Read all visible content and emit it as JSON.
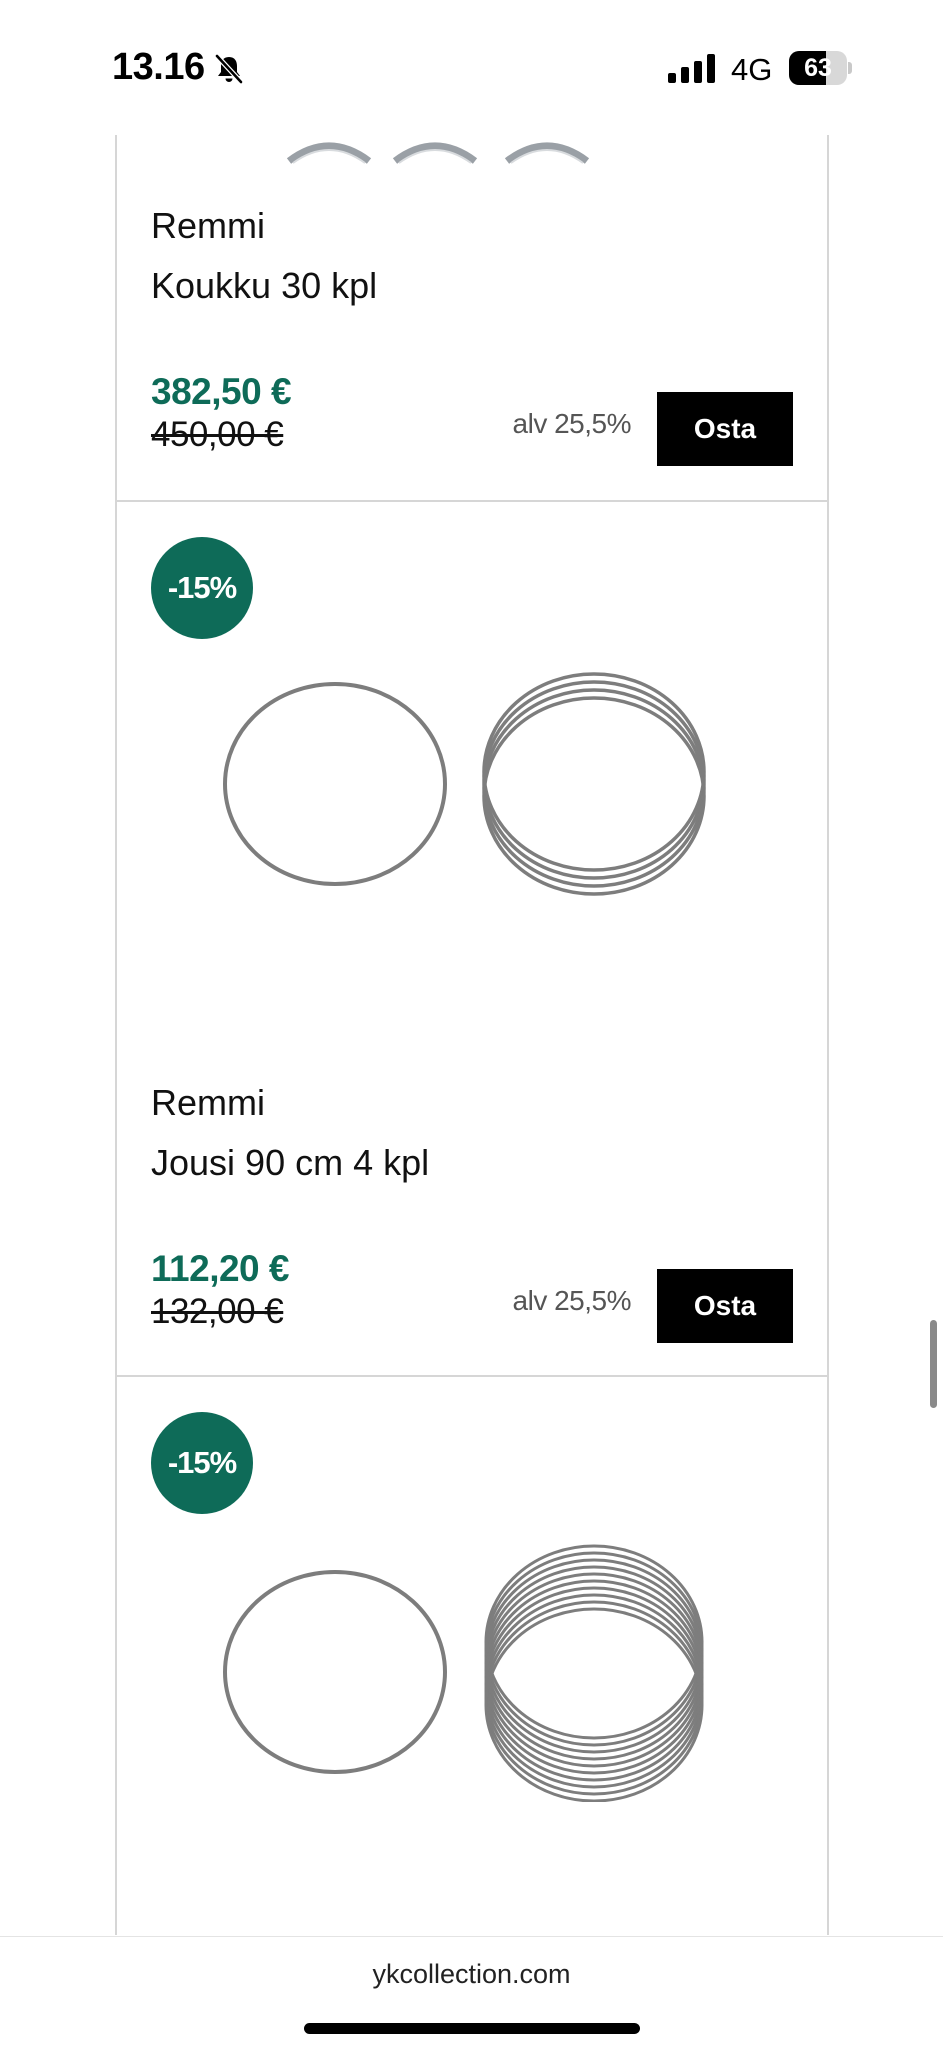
{
  "status_bar": {
    "time": "13.16",
    "network": "4G",
    "battery_level": "63",
    "battery_fraction": 0.63
  },
  "products": [
    {
      "brand": "Remmi",
      "name": "Koukku 30 kpl",
      "price": "382,50 €",
      "old_price": "450,00 €",
      "vat": "alv 25,5%",
      "buy_label": "Osta"
    },
    {
      "badge": "-15%",
      "brand": "Remmi",
      "name": "Jousi 90 cm 4 kpl",
      "price": "112,20 €",
      "old_price": "132,00 €",
      "vat": "alv 25,5%",
      "buy_label": "Osta"
    },
    {
      "badge": "-15%"
    }
  ],
  "browser": {
    "url": "ykcollection.com"
  },
  "colors": {
    "accent": "#0e6b58",
    "button": "#000000"
  }
}
